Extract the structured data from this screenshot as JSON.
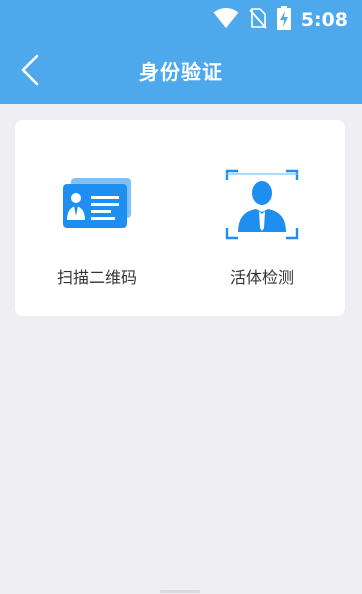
{
  "status_bar": {
    "time": "5:08",
    "icons": [
      "wifi-icon",
      "no-sim-icon",
      "battery-charging-icon"
    ]
  },
  "header": {
    "title": "身份验证",
    "back_icon": "chevron-left-icon"
  },
  "options": [
    {
      "label": "扫描二维码",
      "icon": "id-card-icon"
    },
    {
      "label": "活体检测",
      "icon": "face-scan-icon"
    }
  ],
  "colors": {
    "header_bg": "#4ea8ec",
    "page_bg": "#eeeef3",
    "card_bg": "#ffffff",
    "icon_blue": "#1e8ef0",
    "text": "#333333"
  }
}
